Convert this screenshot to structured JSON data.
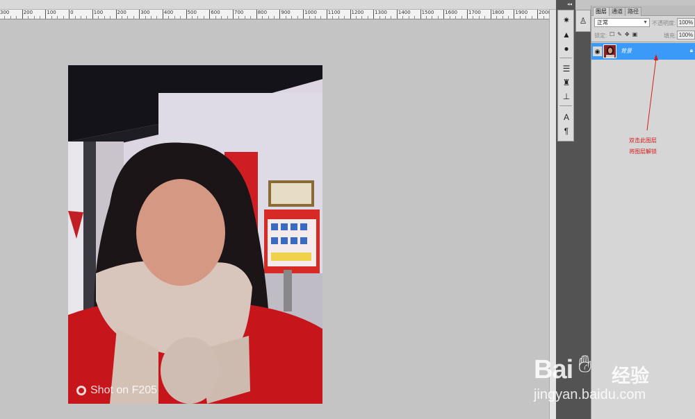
{
  "ruler": {
    "labels": [
      "300",
      "200",
      "100",
      "0",
      "100",
      "200",
      "300",
      "400",
      "500",
      "600",
      "700",
      "800",
      "900",
      "1000",
      "1100",
      "1200",
      "1300",
      "1400",
      "1500",
      "1600",
      "1700",
      "1800",
      "1900",
      "2000"
    ]
  },
  "photo": {
    "caption": "Shot on F205"
  },
  "dock": {
    "tools": [
      "navigator-icon",
      "histogram-icon",
      "info-icon",
      "adjust-icon",
      "clone-icon",
      "brush-preset-icon",
      "character-icon",
      "paragraph-icon"
    ]
  },
  "layers_panel": {
    "tabs": [
      "图层",
      "通道",
      "路径"
    ],
    "active_tab": 0,
    "blend_mode": "正常",
    "opacity_label": "不透明度:",
    "opacity_value": "100%",
    "lock_label": "锁定:",
    "fill_label": "填充:",
    "fill_value": "100%",
    "layer": {
      "name": "背景",
      "selected": true
    }
  },
  "annotation": {
    "line1": "双击此图层",
    "line2": "将图层解锁"
  },
  "watermark": {
    "brand": "Bai",
    "brand_cn": "经验",
    "url": "jingyan.baidu.com"
  },
  "colors": {
    "selection": "#3b99f7",
    "annotation": "#d21b1b"
  }
}
